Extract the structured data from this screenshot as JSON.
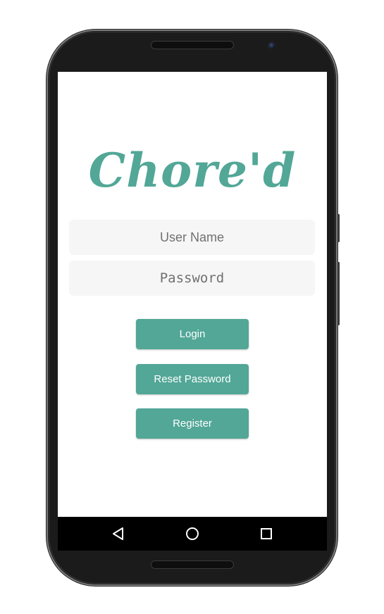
{
  "app": {
    "logo_text": "Chore'd",
    "brand_color": "#52a797"
  },
  "form": {
    "username_placeholder": "User Name",
    "password_placeholder": "Password"
  },
  "buttons": {
    "login_label": "Login",
    "reset_label": "Reset Password",
    "register_label": "Register"
  },
  "navbar": {
    "back_icon": "back-triangle-icon",
    "home_icon": "home-circle-icon",
    "recents_icon": "recents-square-icon"
  }
}
